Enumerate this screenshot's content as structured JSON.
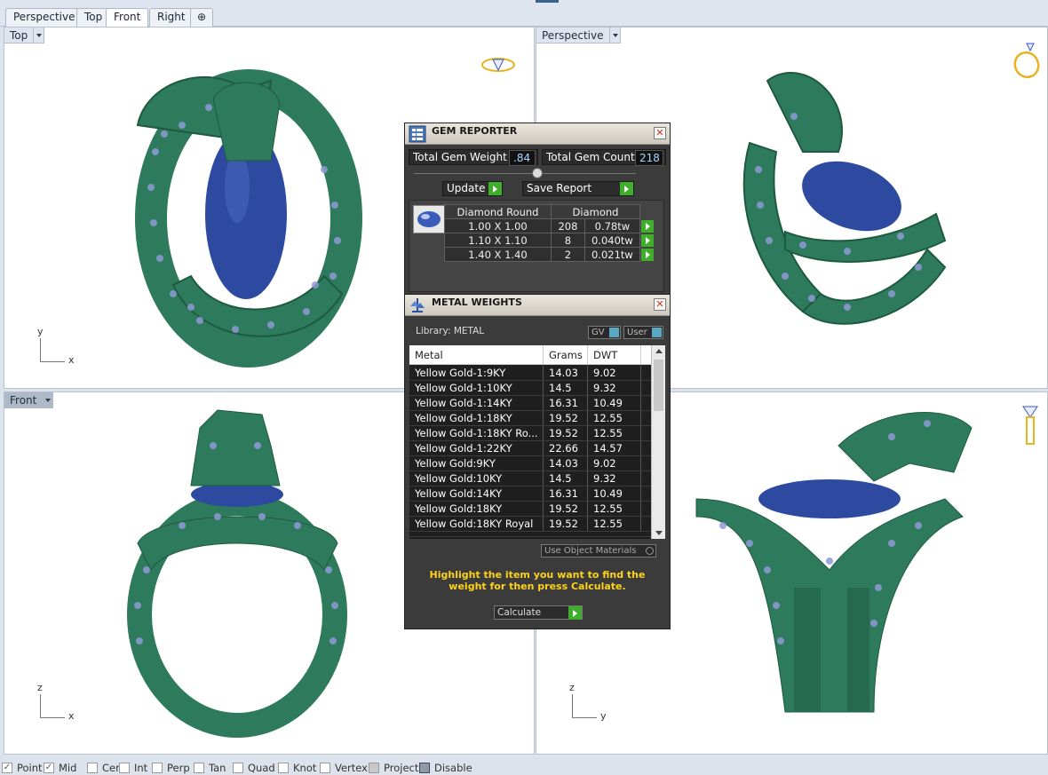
{
  "tabs": [
    "Perspective",
    "Top",
    "Front",
    "Right"
  ],
  "add_tab_symbol": "⊕",
  "active_tab": "Front",
  "viewports": {
    "top": {
      "label": "Top",
      "axis_v": "y",
      "axis_h": "x"
    },
    "perspective": {
      "label": "Perspective"
    },
    "front": {
      "label": "Front",
      "axis_v": "z",
      "axis_h": "x"
    },
    "right": {
      "axis_v": "z",
      "axis_h": "y"
    }
  },
  "gem_reporter": {
    "title": "GEM REPORTER",
    "close": "✕",
    "total_weight_label": "Total Gem Weight",
    "total_weight_value": ".84",
    "total_count_label": "Total Gem Count",
    "total_count_value": "218",
    "update_label": "Update",
    "save_label": "Save Report",
    "table_headers": [
      "Diamond Round",
      "Diamond"
    ],
    "rows": [
      {
        "size": "1.00 X 1.00",
        "count": "208",
        "weight": "0.78tw"
      },
      {
        "size": "1.10 X 1.10",
        "count": "8",
        "weight": "0.040tw"
      },
      {
        "size": "1.40 X 1.40",
        "count": "2",
        "weight": "0.021tw"
      }
    ]
  },
  "metal_weights": {
    "title": "METAL WEIGHTS",
    "close": "✕",
    "library_label": "Library: METAL",
    "gv_label": "GV",
    "user_label": "User",
    "headers": [
      "Metal",
      "Grams",
      "DWT"
    ],
    "rows": [
      {
        "metal": "Yellow Gold-1:9KY",
        "grams": "14.03",
        "dwt": "9.02"
      },
      {
        "metal": "Yellow Gold-1:10KY",
        "grams": "14.5",
        "dwt": "9.32"
      },
      {
        "metal": "Yellow Gold-1:14KY",
        "grams": "16.31",
        "dwt": "10.49"
      },
      {
        "metal": "Yellow Gold-1:18KY",
        "grams": "19.52",
        "dwt": "12.55"
      },
      {
        "metal": "Yellow Gold-1:18KY Ro...",
        "grams": "19.52",
        "dwt": "12.55"
      },
      {
        "metal": "Yellow Gold-1:22KY",
        "grams": "22.66",
        "dwt": "14.57"
      },
      {
        "metal": "Yellow Gold:9KY",
        "grams": "14.03",
        "dwt": "9.02"
      },
      {
        "metal": "Yellow Gold:10KY",
        "grams": "14.5",
        "dwt": "9.32"
      },
      {
        "metal": "Yellow Gold:14KY",
        "grams": "16.31",
        "dwt": "10.49"
      },
      {
        "metal": "Yellow Gold:18KY",
        "grams": "19.52",
        "dwt": "12.55"
      },
      {
        "metal": "Yellow Gold:18KY Royal",
        "grams": "19.52",
        "dwt": "12.55"
      }
    ],
    "use_object_materials": "Use Object Materials",
    "instruction": "Highlight the item you want to find the weight for then press Calculate.",
    "calculate_label": "Calculate"
  },
  "status_bar": {
    "snaps": [
      {
        "label": "Point",
        "checked": true
      },
      {
        "label": "Mid",
        "checked": true
      },
      {
        "label": "Cen",
        "checked": false
      },
      {
        "label": "Int",
        "checked": false
      },
      {
        "label": "Perp",
        "checked": false
      },
      {
        "label": "Tan",
        "checked": false
      },
      {
        "label": "Quad",
        "checked": false
      },
      {
        "label": "Knot",
        "checked": false
      },
      {
        "label": "Vertex",
        "checked": false
      },
      {
        "label": "Project",
        "checked": false
      },
      {
        "label": "Disable",
        "checked": false
      }
    ]
  },
  "colors": {
    "ring_green": "#2e7a5c",
    "gem_blue": "#2d4aa0",
    "accent_yellow": "#ffd21a",
    "button_green": "#3fae2a"
  }
}
